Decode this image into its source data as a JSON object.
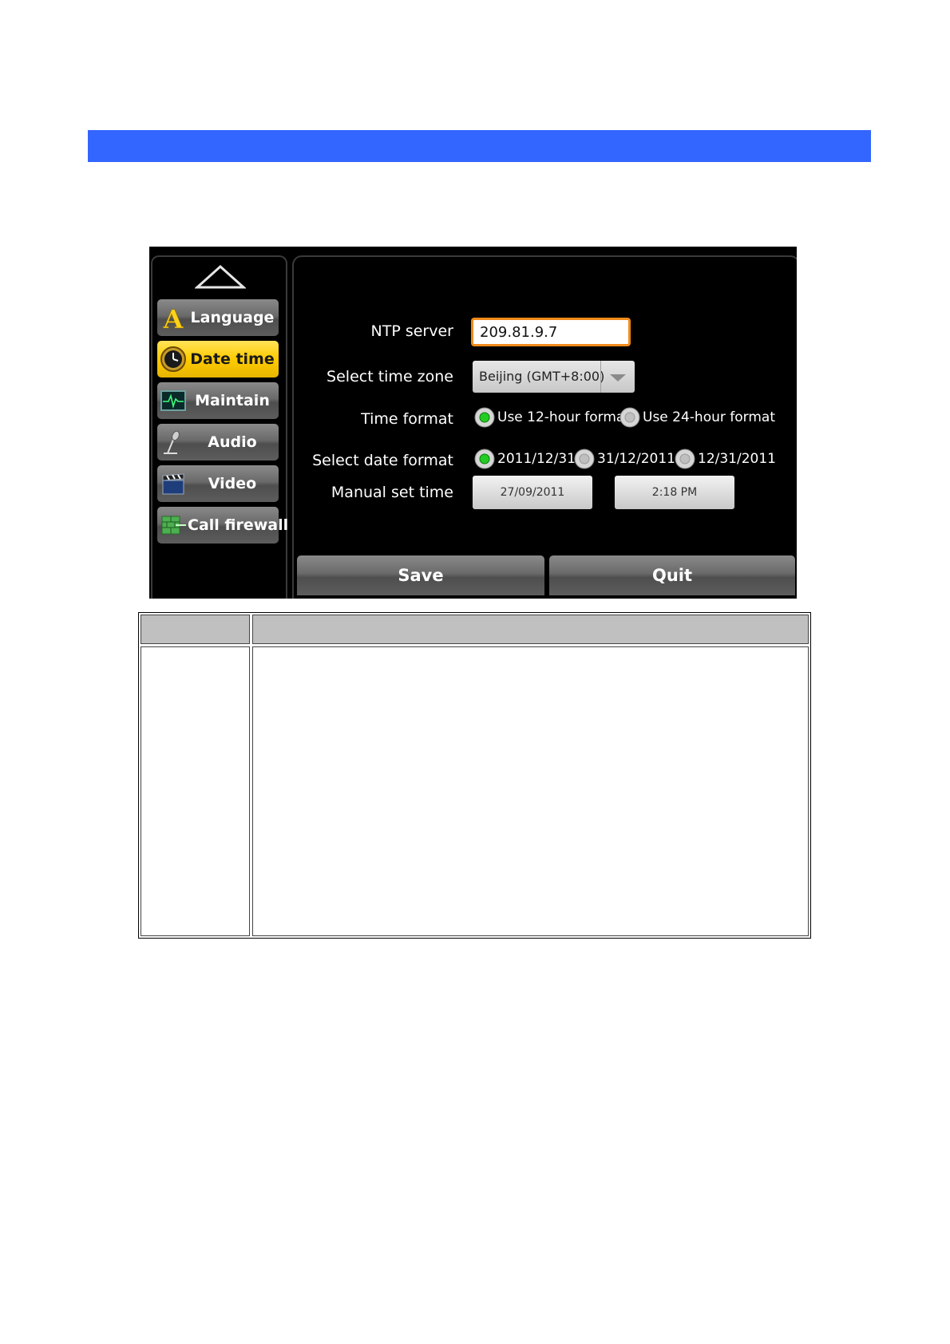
{
  "colors": {
    "header_bar": "#3366ff",
    "active_nav": "#ffcc00",
    "input_focus_border": "#f08a1a",
    "radio_selected": "#22cc22"
  },
  "sidebar": {
    "scroll_up_icon": "triangle-up-icon",
    "items": [
      {
        "label": "Language",
        "icon": "language-a-icon",
        "active": false
      },
      {
        "label": "Date time",
        "icon": "clock-icon",
        "active": true
      },
      {
        "label": "Maintain",
        "icon": "heartbeat-monitor-icon",
        "active": false
      },
      {
        "label": "Audio",
        "icon": "microphone-icon",
        "active": false
      },
      {
        "label": "Video",
        "icon": "clapperboard-icon",
        "active": false
      },
      {
        "label": "Call firewall",
        "icon": "firewall-icon",
        "active": false
      }
    ]
  },
  "form": {
    "ntp_server": {
      "label": "NTP server",
      "value": "209.81.9.7"
    },
    "time_zone": {
      "label": "Select time zone",
      "value": "Beijing (GMT+8:00)"
    },
    "time_format": {
      "label": "Time format",
      "options": [
        {
          "label": "Use 12-hour format",
          "selected": true
        },
        {
          "label": "Use 24-hour format",
          "selected": false
        }
      ]
    },
    "date_format": {
      "label": "Select date format",
      "options": [
        {
          "label": "2011/12/31",
          "selected": true
        },
        {
          "label": "31/12/2011",
          "selected": false
        },
        {
          "label": "12/31/2011",
          "selected": false
        }
      ]
    },
    "manual_time": {
      "label": "Manual set time",
      "date_value": "27/09/2011",
      "time_value": "2:18 PM"
    }
  },
  "actions": {
    "save_label": "Save",
    "quit_label": "Quit"
  }
}
